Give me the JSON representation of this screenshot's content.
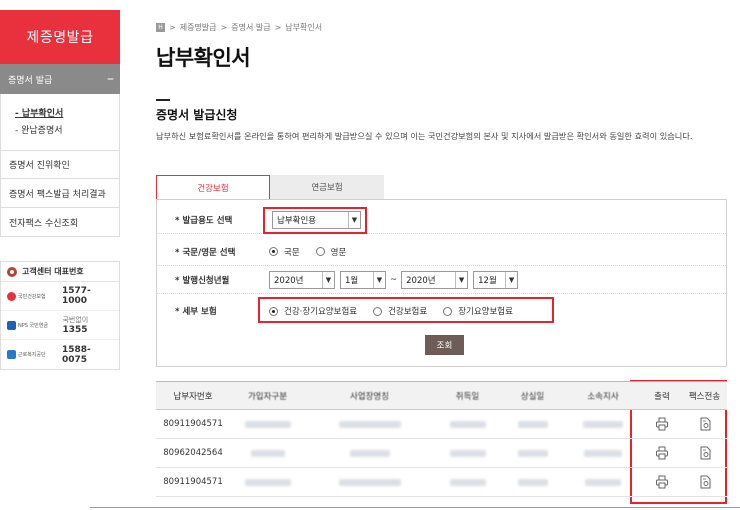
{
  "sidebar": {
    "title": "제증명발급",
    "section": "증명서 발급",
    "collapse_symbol": "–",
    "subitems": [
      "- 납부확인서",
      "- 완납증명서"
    ],
    "items": [
      "증명서 진위확인",
      "증명서 팩스발급 처리결과",
      "전자팩스 수신조회"
    ],
    "contact_title": "고객센터 대표번호",
    "contacts": [
      {
        "org": "국민건강보험",
        "prefix": "",
        "number": "1577-1000"
      },
      {
        "org": "NPS 국민연금",
        "prefix": "국번없이",
        "number": "1355"
      },
      {
        "org": "근로복지공단",
        "prefix": "",
        "number": "1588-0075"
      }
    ]
  },
  "breadcrumb": [
    "제증명발급",
    "증명서 발급",
    "납부확인서"
  ],
  "page_title": "납부확인서",
  "section_title": "증명서 발급신청",
  "description": "납부하신 보험료확인서를 온라인을 통하여 편리하게 발급받으실 수 있으며 이는 국민건강보험의 본사 및 지사에서 발급받은 확인서와 동일한 효력이 있습니다.",
  "tabs": [
    {
      "label": "건강보험",
      "active": true
    },
    {
      "label": "연금보험",
      "active": false
    }
  ],
  "form": {
    "purpose": {
      "label": "발급용도 선택",
      "value": "납부확인용"
    },
    "language": {
      "label": "국문/영문 선택",
      "options": [
        "국문",
        "영문"
      ],
      "selected": "국문"
    },
    "period": {
      "label": "발행신청년월",
      "from_year": "2020년",
      "from_month": "1월",
      "tilde": "~",
      "to_year": "2020년",
      "to_month": "12월"
    },
    "insurance": {
      "label": "세부 보험",
      "options": [
        "건강·장기요양보험료",
        "건강보험료",
        "장기요양보험료"
      ],
      "selected": "건강·장기요양보험료"
    },
    "star": "*",
    "search_button": "조회"
  },
  "table": {
    "headers": [
      "납부자번호",
      "가입자구분",
      "사업장명칭",
      "취득일",
      "상실일",
      "소속지사",
      "출력",
      "팩스전송"
    ],
    "rows": [
      {
        "payer_no": "80911904571"
      },
      {
        "payer_no": "80962042564"
      },
      {
        "payer_no": "80911904571"
      }
    ]
  },
  "colors": {
    "brand_red": "#e8313d",
    "highlight_red": "#e5232e",
    "sidebar_gray": "#8a8a8a",
    "button_brown": "#6e5c56"
  },
  "icons": [
    "home-icon",
    "printer-icon",
    "fax-document-icon",
    "headset-icon"
  ]
}
